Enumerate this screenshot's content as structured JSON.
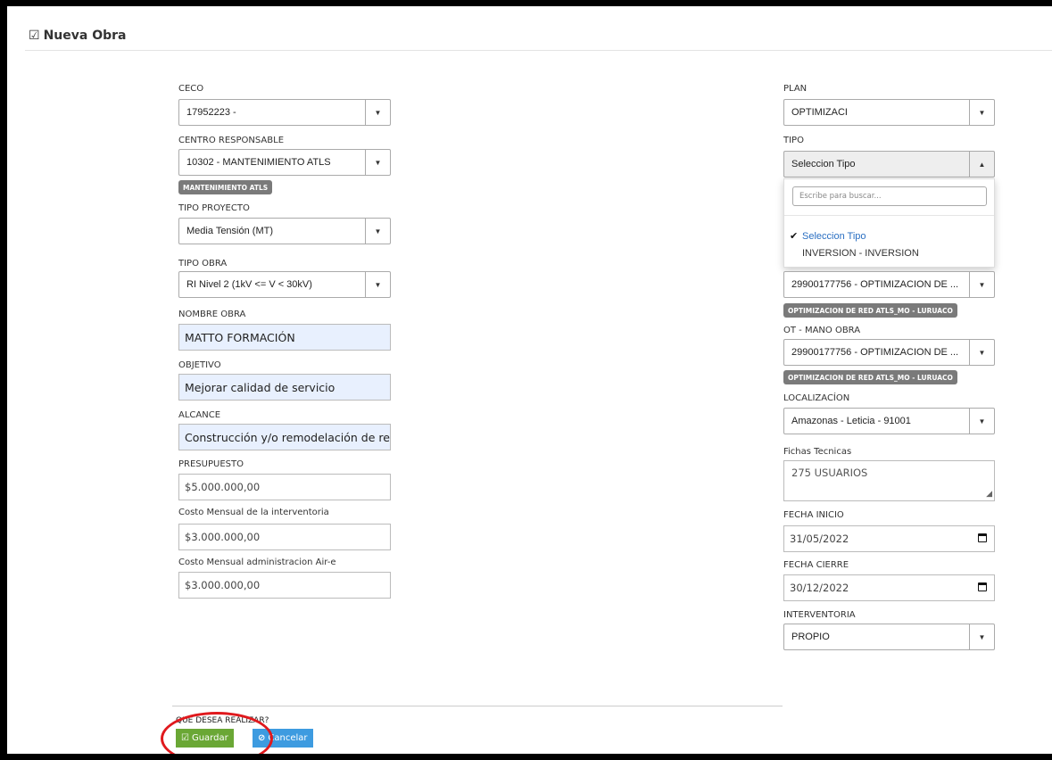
{
  "page": {
    "title": "Nueva Obra"
  },
  "left": {
    "ceco": {
      "label": "CECO",
      "value": "17952223 -"
    },
    "centro": {
      "label": "CENTRO RESPONSABLE",
      "value": "10302 - MANTENIMIENTO ATLS",
      "badge": "MANTENIMIENTO ATLS"
    },
    "tipo_proyecto": {
      "label": "TIPO PROYECTO",
      "value": "Media Tensión (MT)"
    },
    "tipo_obra": {
      "label": "TIPO OBRA",
      "value": "RI Nivel 2 (1kV <= V < 30kV)"
    },
    "nombre_obra": {
      "label": "NOMBRE OBRA",
      "value": "MATTO FORMACIÓN"
    },
    "objetivo": {
      "label": "OBJETIVO",
      "value": "Mejorar calidad de servicio"
    },
    "alcance": {
      "label": "ALCANCE",
      "value": "Construcción y/o remodelación de redes I"
    },
    "presupuesto": {
      "label": "PRESUPUESTO",
      "value": "$5.000.000,00"
    },
    "costo_interventoria": {
      "label": "Costo Mensual de la interventoria",
      "value": "$3.000.000,00"
    },
    "costo_admin": {
      "label": "Costo Mensual administracion Air-e",
      "value": "$3.000.000,00"
    }
  },
  "right": {
    "plan": {
      "label": "PLAN",
      "value": "OPTIMIZACI"
    },
    "tipo": {
      "label": "TIPO",
      "value": "Seleccion Tipo"
    },
    "tipo_dropdown": {
      "search_placeholder": "Escribe para buscar...",
      "options": [
        "Seleccion Tipo",
        "INVERSION - INVERSION"
      ]
    },
    "ot_material": {
      "value": "29900177756 - OPTIMIZACION DE ...",
      "badge": "OPTIMIZACION DE RED ATLS_MO - LURUACO"
    },
    "ot_mano_obra": {
      "label": "OT - MANO OBRA",
      "value": "29900177756 - OPTIMIZACION DE ...",
      "badge": "OPTIMIZACION DE RED ATLS_MO - LURUACO"
    },
    "localizacion": {
      "label": "LOCALIZACÍON",
      "value": "Amazonas - Leticia - 91001"
    },
    "fichas": {
      "label": "Fichas Tecnicas",
      "value": "275 USUARIOS"
    },
    "fecha_inicio": {
      "label": "FECHA INICIO",
      "value": "31/05/2022"
    },
    "fecha_cierre": {
      "label": "FECHA CIERRE",
      "value": "30/12/2022"
    },
    "interventoria": {
      "label": "INTERVENTORIA",
      "value": "PROPIO"
    }
  },
  "footer": {
    "question": "QUE DESEA REALIZAR?",
    "save_label": "Guardar",
    "cancel_label": "Cancelar"
  },
  "colors": {
    "save": "#6aa735",
    "cancel": "#3d9be0",
    "badge": "#7a7a7a",
    "highlight_circle": "#e0191d"
  }
}
